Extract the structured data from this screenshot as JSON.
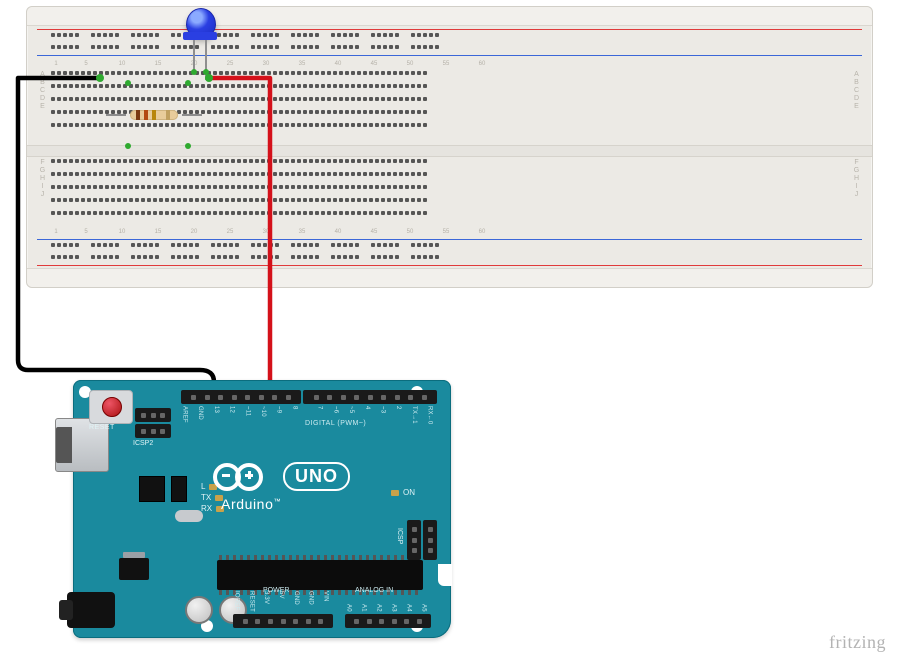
{
  "watermark": "fritzing",
  "breadboard": {
    "rowsTop": [
      "A",
      "B",
      "C",
      "D",
      "E"
    ],
    "rowsBot": [
      "F",
      "G",
      "H",
      "I",
      "J"
    ],
    "cols": 63
  },
  "led": {
    "color": "blue"
  },
  "resistor": {
    "bands": [
      "brown",
      "orange",
      "gold",
      "tolerance"
    ]
  },
  "wires": {
    "gnd": {
      "color": "#000000",
      "from": "breadboard row A near col 7",
      "to": "Arduino GND"
    },
    "signal": {
      "color": "#d4111a",
      "from": "breadboard LED anode",
      "to": "Arduino digital pin 8"
    }
  },
  "arduino": {
    "brand": "Arduino",
    "model": "UNO",
    "resetLabel": "RESET",
    "icsp2Label": "ICSP2",
    "icspLabel": "ICSP",
    "digitalLabel": "DIGITAL (PWM~)",
    "powerLabel": "POWER",
    "analogLabel": "ANALOG IN",
    "onLabel": "ON",
    "lLabel": "L",
    "txLabel": "TX",
    "rxLabel": "RX",
    "digitalPins": [
      "AREF",
      "GND",
      "13",
      "12",
      "~11",
      "~10",
      "~9",
      "8",
      "",
      "7",
      "~6",
      "~5",
      "4",
      "~3",
      "2",
      "TX→1",
      "RX←0"
    ],
    "powerPins": [
      "IOREF",
      "RESET",
      "3.3V",
      "5V",
      "GND",
      "GND",
      "VIN"
    ],
    "analogPins": [
      "A0",
      "A1",
      "A2",
      "A3",
      "A4",
      "A5"
    ]
  }
}
